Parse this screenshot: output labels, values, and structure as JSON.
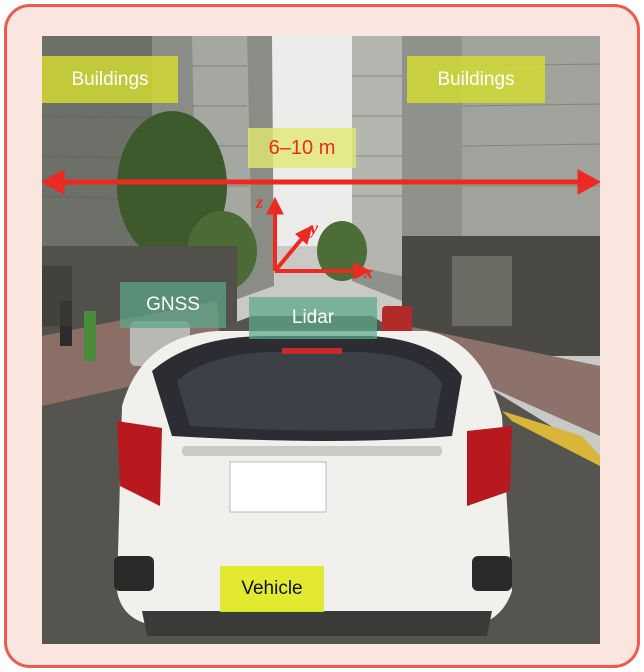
{
  "labels": {
    "buildings_left": "Buildings",
    "buildings_right": "Buildings",
    "range": "6–10 m",
    "gnss": "GNSS",
    "lidar": "Lidar",
    "vehicle": "Vehicle"
  },
  "axes": {
    "x": "x",
    "y": "y",
    "z": "z"
  },
  "colors": {
    "frame_border": "#ee5a4e",
    "frame_fill": "#fbe6df",
    "annotation_red": "#ec2a22",
    "buildings_label": "#d6de30",
    "sensor_label": "#5ca88a",
    "vehicle_label": "#e2e81e"
  }
}
